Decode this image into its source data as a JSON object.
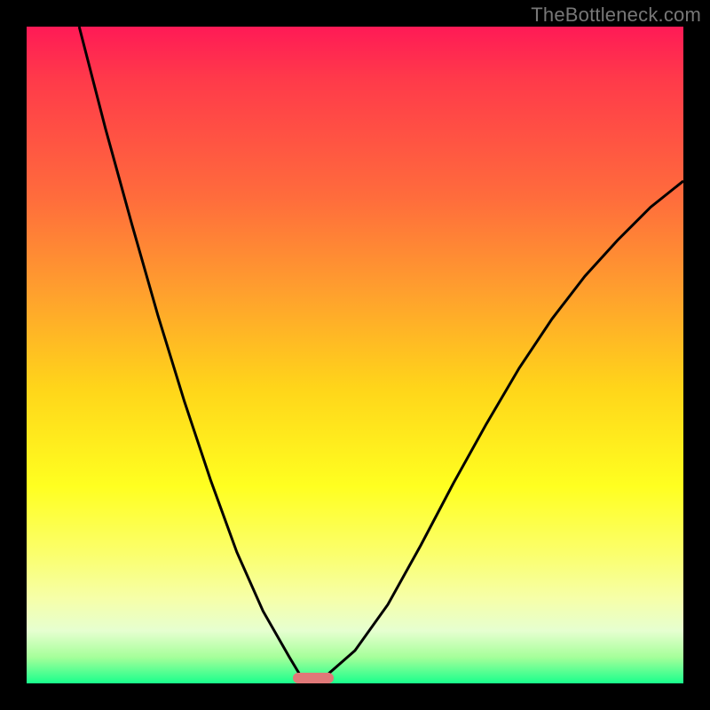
{
  "watermark": "TheBottleneck.com",
  "colors": {
    "frame": "#000000",
    "gradient_stops": [
      {
        "pct": 0,
        "hex": "#ff1a56"
      },
      {
        "pct": 8,
        "hex": "#ff3a4a"
      },
      {
        "pct": 26,
        "hex": "#ff6c3c"
      },
      {
        "pct": 40,
        "hex": "#ff9e2e"
      },
      {
        "pct": 55,
        "hex": "#ffd51a"
      },
      {
        "pct": 70,
        "hex": "#ffff20"
      },
      {
        "pct": 80,
        "hex": "#fbff6a"
      },
      {
        "pct": 87,
        "hex": "#f6ffa8"
      },
      {
        "pct": 92,
        "hex": "#e6ffd0"
      },
      {
        "pct": 96,
        "hex": "#a6ff9a"
      },
      {
        "pct": 100,
        "hex": "#19ff8c"
      }
    ],
    "marker": "#e07878",
    "curve": "#000000"
  },
  "chart_data": {
    "type": "line",
    "title": "",
    "xlabel": "",
    "ylabel": "",
    "xlim": [
      0,
      100
    ],
    "ylim": [
      0,
      100
    ],
    "marker": {
      "x_range": [
        40.5,
        46.8
      ],
      "y": 0.8
    },
    "series": [
      {
        "name": "left-branch",
        "x": [
          8.0,
          12.0,
          16.0,
          20.0,
          24.0,
          28.0,
          32.0,
          36.0,
          40.0,
          41.5
        ],
        "y": [
          100.0,
          84.5,
          70.0,
          56.0,
          43.0,
          31.0,
          20.0,
          11.0,
          4.0,
          1.5
        ]
      },
      {
        "name": "right-branch",
        "x": [
          46.0,
          50.0,
          55.0,
          60.0,
          65.0,
          70.0,
          75.0,
          80.0,
          85.0,
          90.0,
          95.0,
          100.0
        ],
        "y": [
          1.5,
          5.0,
          12.0,
          21.0,
          30.5,
          39.5,
          48.0,
          55.5,
          62.0,
          67.5,
          72.5,
          76.5
        ]
      }
    ]
  }
}
